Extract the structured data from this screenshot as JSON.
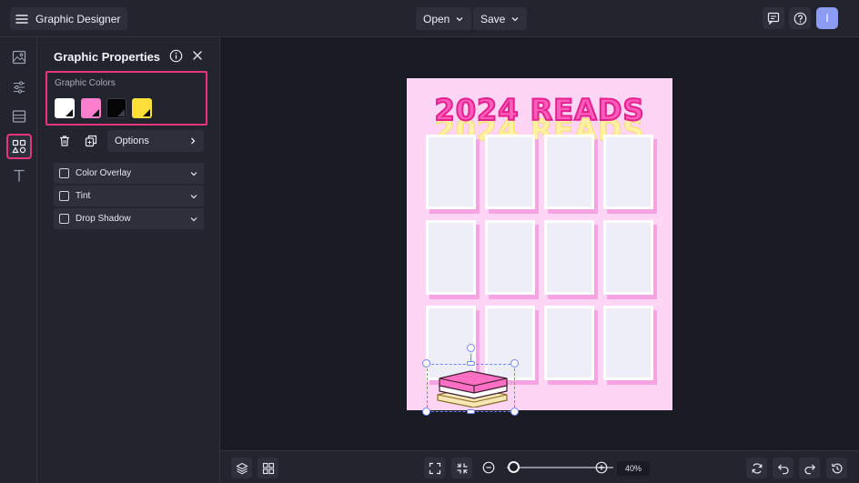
{
  "app": {
    "title": "Graphic Designer",
    "menu_icon": "hamburger-icon"
  },
  "topbar": {
    "open_label": "Open",
    "save_label": "Save",
    "avatar_initial": "I"
  },
  "rail": {
    "items": [
      "image-icon",
      "sliders-icon",
      "layout-icon",
      "shapes-icon",
      "text-icon"
    ],
    "active_item": "shapes-icon"
  },
  "panel": {
    "title": "Graphic Properties",
    "colors_label": "Graphic Colors",
    "swatches": [
      "#ffffff",
      "#ff7fcf",
      "#050505",
      "#ffe03a"
    ],
    "options_label": "Options",
    "accordions": [
      {
        "label": "Color Overlay",
        "checked": false
      },
      {
        "label": "Tint",
        "checked": false
      },
      {
        "label": "Drop Shadow",
        "checked": false
      }
    ]
  },
  "canvas": {
    "headline": "2024 READS",
    "background_color": "#ffd5f5",
    "headline_color": "#ff5cbc",
    "headline_shadow_color": "#fff2a8",
    "card_count": 12
  },
  "bottombar": {
    "zoom": "40%",
    "zoom_fraction": 0.06
  },
  "colors": {
    "accent": "#e8357a",
    "selection": "#6f86ff",
    "avatar": "#8c9cf2"
  }
}
